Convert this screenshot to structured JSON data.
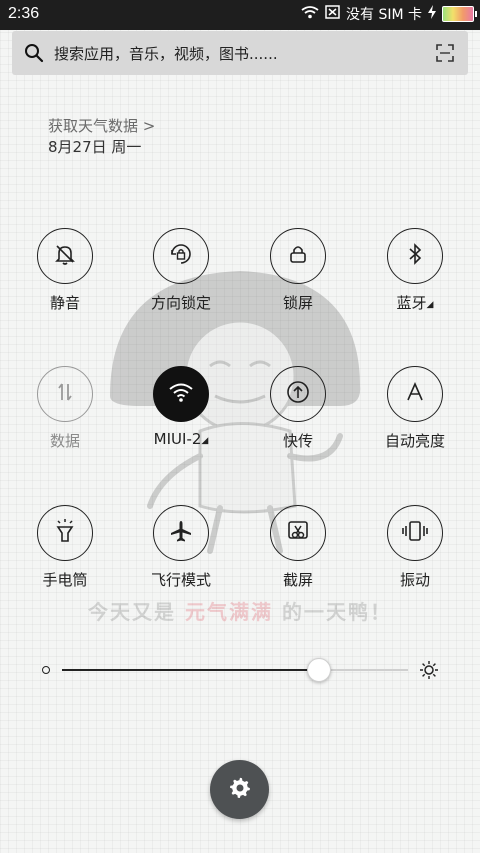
{
  "status_bar": {
    "time": "2:36",
    "carrier": "没有 SIM 卡",
    "icons": [
      "wifi-icon",
      "no-sim-icon",
      "charging-icon",
      "battery-icon"
    ]
  },
  "search": {
    "placeholder": "搜索应用，音乐，视频，图书......",
    "icons": [
      "search-icon",
      "scan-icon"
    ]
  },
  "weather": {
    "link_text": "获取天气数据 >",
    "date": "8月27日 周一"
  },
  "watermark": {
    "slogan_pre": "今天又是",
    "slogan_highlight": "元气满满",
    "slogan_post": "的一天鸭！"
  },
  "toggles": [
    {
      "label": "静音",
      "icon": "bell-off-icon",
      "state": "off"
    },
    {
      "label": "方向锁定",
      "icon": "rotation-lock-icon",
      "state": "off"
    },
    {
      "label": "锁屏",
      "icon": "lock-icon",
      "state": "off"
    },
    {
      "label": "蓝牙",
      "icon": "bluetooth-icon",
      "state": "off",
      "has_menu": true
    },
    {
      "label": "数据",
      "icon": "mobile-data-icon",
      "state": "disabled"
    },
    {
      "label": "MIUI-2",
      "icon": "wifi-icon",
      "state": "on",
      "has_menu": true
    },
    {
      "label": "快传",
      "icon": "quick-share-icon",
      "state": "off"
    },
    {
      "label": "自动亮度",
      "icon": "auto-brightness-icon",
      "state": "off"
    },
    {
      "label": "手电筒",
      "icon": "flashlight-icon",
      "state": "off"
    },
    {
      "label": "飞行模式",
      "icon": "airplane-icon",
      "state": "off"
    },
    {
      "label": "截屏",
      "icon": "screenshot-icon",
      "state": "off"
    },
    {
      "label": "振动",
      "icon": "vibrate-icon",
      "state": "off"
    }
  ],
  "brightness": {
    "level_fraction": 0.74
  },
  "settings_button": {
    "icon": "gear-icon"
  },
  "colors": {
    "status_bar_bg": "#1e1e1e",
    "search_bg": "#d8d8d8",
    "toggle_on_bg": "#111111",
    "fab_bg": "#4e5153"
  }
}
